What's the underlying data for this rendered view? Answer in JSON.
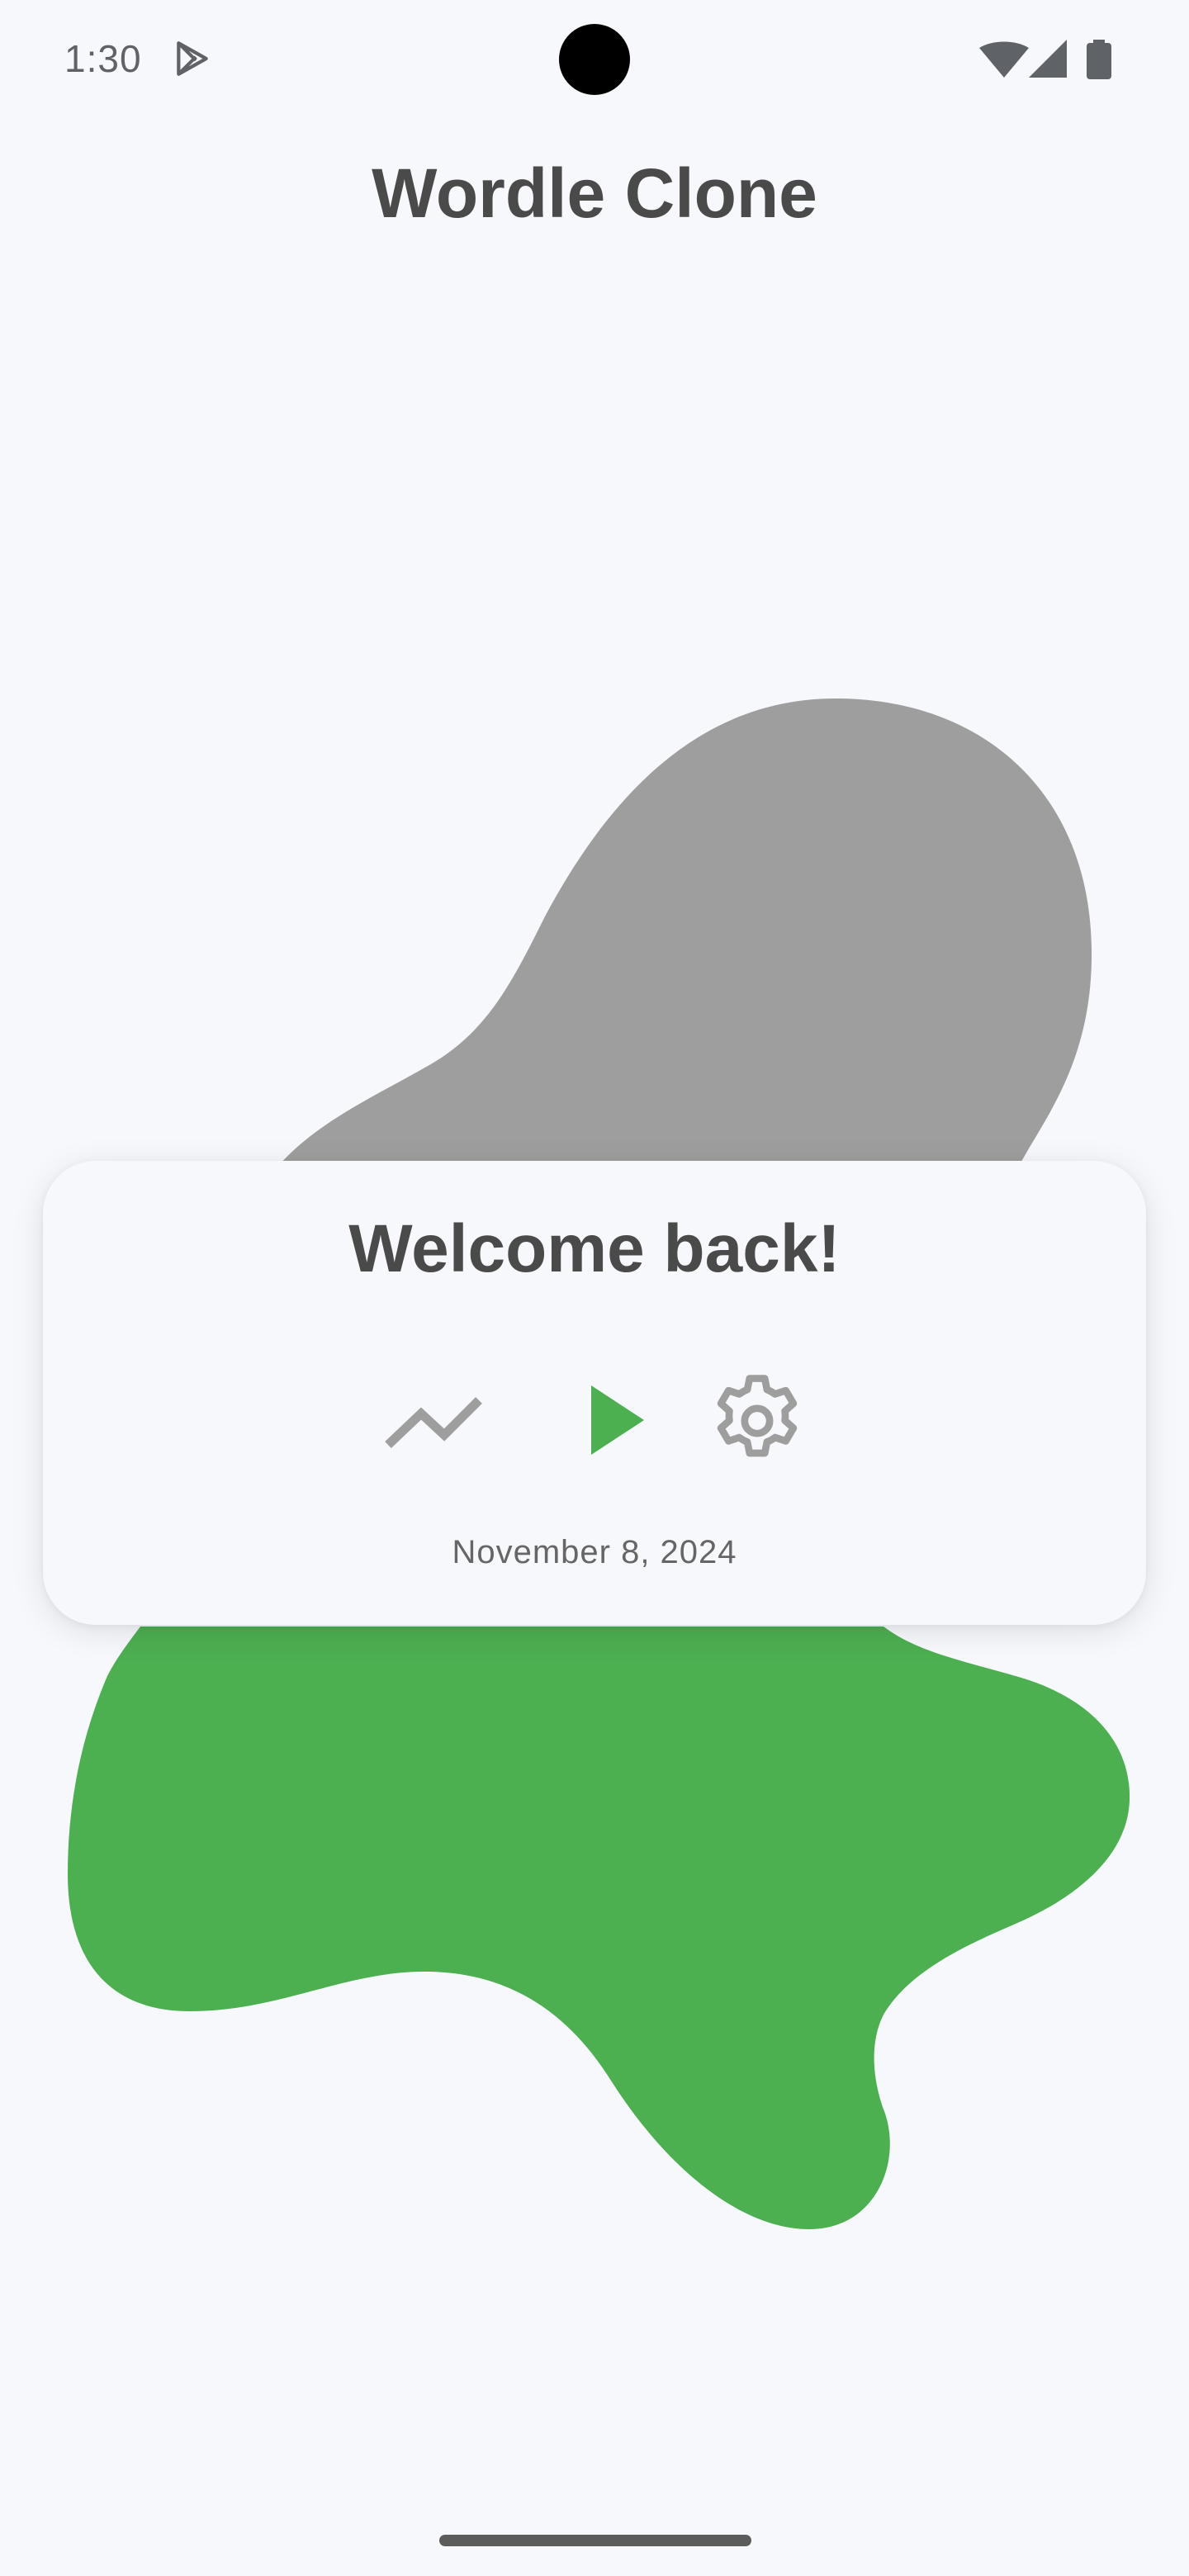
{
  "status_bar": {
    "time": "1:30",
    "icons": [
      "play-store-icon",
      "wifi-icon",
      "signal-icon",
      "battery-icon"
    ]
  },
  "app": {
    "title": "Wordle Clone"
  },
  "card": {
    "title": "Welcome back!",
    "actions": [
      {
        "name": "stats",
        "icon": "trending-up-icon"
      },
      {
        "name": "play",
        "icon": "play-icon"
      },
      {
        "name": "settings",
        "icon": "gear-icon"
      }
    ],
    "date": "November 8, 2024"
  },
  "colors": {
    "background": "#f7f8fc",
    "accent_green": "#4caf50",
    "blob_gray": "#9e9e9e",
    "text_dark": "#4a4a4a",
    "icon_gray": "#9e9e9e"
  }
}
